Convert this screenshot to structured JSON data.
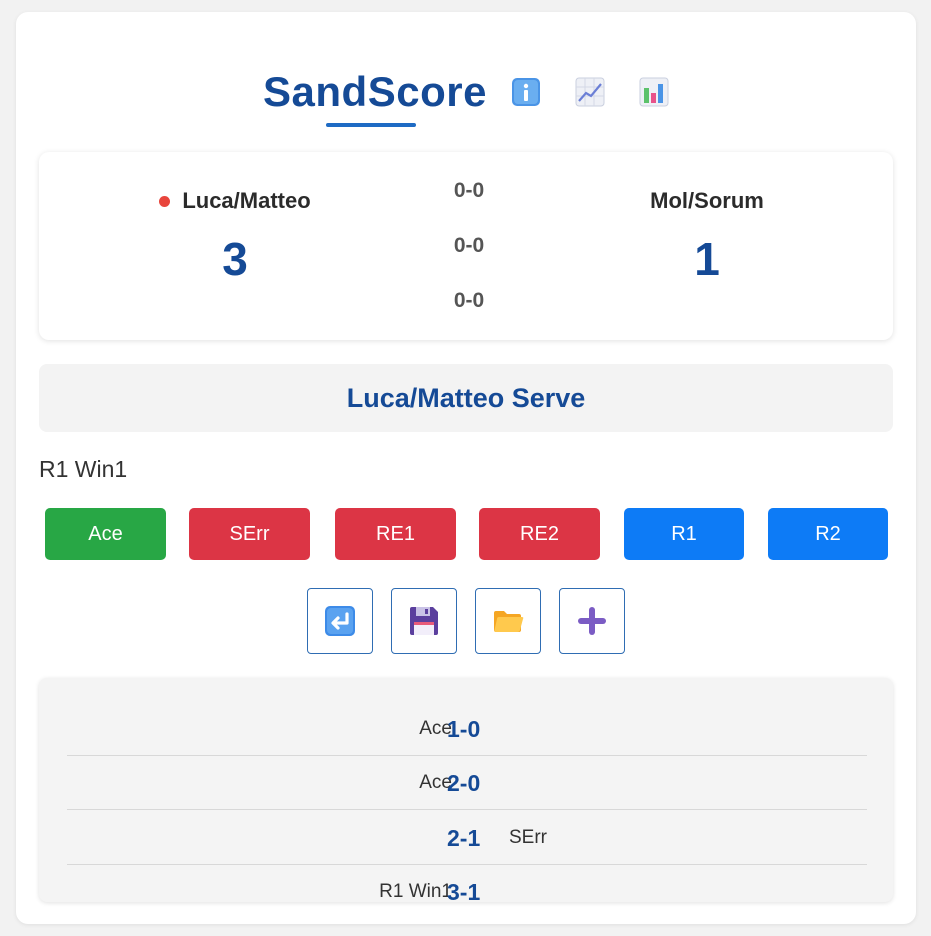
{
  "app": {
    "title": "SandScore",
    "header_icons": [
      "info-icon",
      "line-chart-icon",
      "bar-chart-icon"
    ]
  },
  "scoreboard": {
    "team_a": {
      "name": "Luca/Matteo",
      "score": "3",
      "serving": true
    },
    "team_b": {
      "name": "Mol/Sorum",
      "score": "1"
    },
    "sets": [
      "0-0",
      "0-0",
      "0-0"
    ]
  },
  "serve_banner": "Luca/Matteo Serve",
  "status_text": "R1 Win1",
  "actions": [
    {
      "label": "Ace",
      "color": "#28a745"
    },
    {
      "label": "SErr",
      "color": "#dc3545"
    },
    {
      "label": "RE1",
      "color": "#dc3545"
    },
    {
      "label": "RE2",
      "color": "#dc3545"
    },
    {
      "label": "R1",
      "color": "#0d7bf6"
    },
    {
      "label": "R2",
      "color": "#0d7bf6"
    }
  ],
  "tools": [
    "undo-icon",
    "save-icon",
    "folder-icon",
    "plus-icon"
  ],
  "log": [
    {
      "left": "Ace",
      "score": "1-0",
      "right": ""
    },
    {
      "left": "Ace",
      "score": "2-0",
      "right": ""
    },
    {
      "left": "",
      "score": "2-1",
      "right": "SErr"
    },
    {
      "left": "R1 Win1",
      "score": "3-1",
      "right": ""
    }
  ],
  "colors": {
    "brand": "#154a96",
    "serve_dot": "#e8453c"
  }
}
